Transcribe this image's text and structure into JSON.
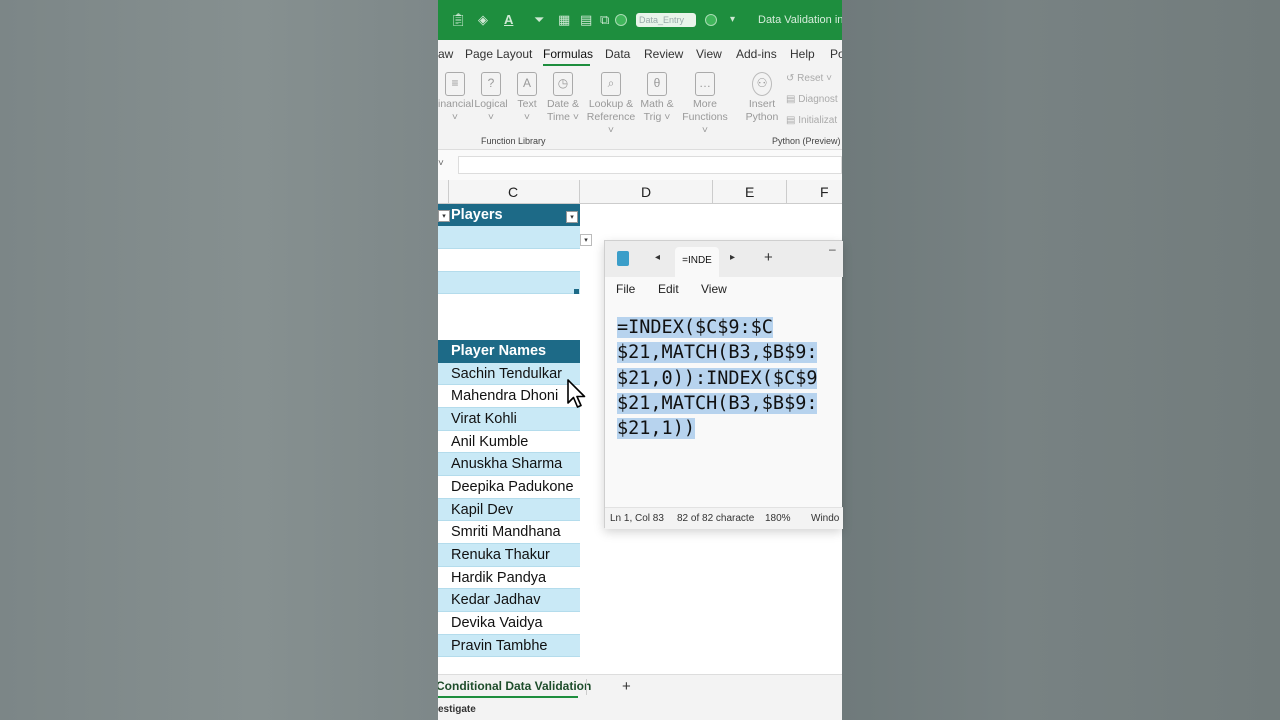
{
  "titlebar": {
    "name_box": "Data_Entry",
    "doc_title": "Data Validation in E"
  },
  "menu": {
    "tabs": [
      "aw",
      "Page Layout",
      "Formulas",
      "Data",
      "Review",
      "View",
      "Add-ins",
      "Help",
      "Po"
    ],
    "active": "Formulas"
  },
  "ribbon": {
    "buttons": [
      {
        "label1": "inancial",
        "label2": "˅",
        "icon": "database-icon"
      },
      {
        "label1": "Logical",
        "label2": "˅",
        "icon": "question-icon"
      },
      {
        "label1": "Text",
        "label2": "˅",
        "icon": "text-icon"
      },
      {
        "label1": "Date &",
        "label2": "Time ˅",
        "icon": "clock-icon"
      },
      {
        "label1": "Lookup &",
        "label2": "Reference ˅",
        "icon": "search-icon"
      },
      {
        "label1": "Math &",
        "label2": "Trig ˅",
        "icon": "theta-icon"
      },
      {
        "label1": "More",
        "label2": "Functions ˅",
        "icon": "more-icon"
      },
      {
        "label1": "Insert",
        "label2": "Python",
        "icon": "python-icon"
      }
    ],
    "group_function_library": "Function Library",
    "group_python": "Python (Preview)",
    "python_reset": "Reset",
    "python_diagnostics": "Diagnost",
    "python_initialization": "Initializat"
  },
  "columns": [
    "C",
    "D",
    "E",
    "F"
  ],
  "table1": {
    "header": "Players"
  },
  "table2": {
    "header": "Player Names",
    "rows": [
      "Sachin Tendulkar",
      "Mahendra Dhoni",
      "Virat Kohli",
      "Anil Kumble",
      "Anuskha Sharma",
      "Deepika Padukone",
      "Kapil Dev",
      "Smriti Mandhana",
      "Renuka Thakur",
      "Hardik Pandya",
      "Kedar Jadhav",
      "Devika Vaidya",
      "Pravin Tambhe"
    ]
  },
  "notepad": {
    "tab_title": "=INDE",
    "menu": [
      "File",
      "Edit",
      "View"
    ],
    "lines": [
      "=INDEX($C$9:$C",
      "$21,MATCH(B3,$B$9:",
      "$21,0)):INDEX($C$9",
      "$21,MATCH(B3,$B$9:",
      "$21,1))"
    ],
    "status": {
      "position": "Ln 1, Col 83",
      "chars": "82 of 82 characte",
      "zoom": "180%",
      "eol": "Windo"
    }
  },
  "sheet": {
    "tab": "Conditional Data Validation",
    "add": "+"
  },
  "statusbar": {
    "text": "estigate"
  },
  "colors": {
    "excel_green": "#1e8e3e",
    "table_header": "#1d6a87",
    "table_band": "#c9e9f6",
    "selection": "#b7d3ee"
  }
}
